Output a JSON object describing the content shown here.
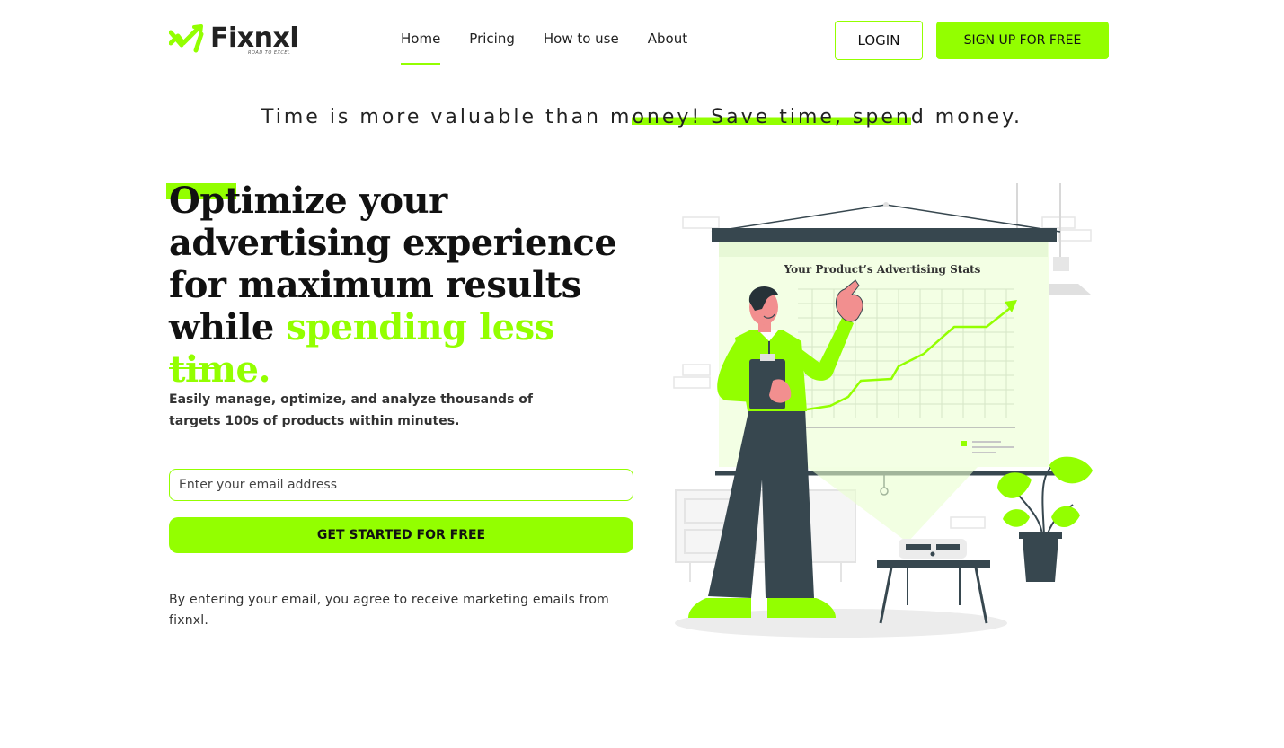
{
  "brand": {
    "name": "Fixnxl",
    "tagline": "ROAD TO EXCEL",
    "accent_color": "#93ff00"
  },
  "nav": {
    "items": [
      {
        "label": "Home",
        "active": true
      },
      {
        "label": "Pricing",
        "active": false
      },
      {
        "label": "How to use",
        "active": false
      },
      {
        "label": "About",
        "active": false
      }
    ],
    "login_label": "LOGIN",
    "signup_label": "SIGN UP FOR FREE"
  },
  "tagline": {
    "part1": "Time is more valuable than m",
    "highlight": "oney! Save time, spen",
    "part2": "d money."
  },
  "hero": {
    "title_main": "Optimize your advertising experience for maximum results while ",
    "title_accent": "spending less time.",
    "description": "Easily manage, optimize, and analyze thousands of targets 100s of products within minutes.",
    "email_placeholder": "Enter your email address",
    "cta_label": "GET STARTED FOR FREE",
    "consent": "By entering your email, you agree to receive marketing emails from fixnxl."
  },
  "illustration": {
    "screen_title": "Your Product’s Advertising Stats",
    "icons": [
      "presenter-person",
      "projector-screen",
      "trend-arrow",
      "potted-plant",
      "projector",
      "side-table",
      "ceiling-lamp"
    ]
  }
}
